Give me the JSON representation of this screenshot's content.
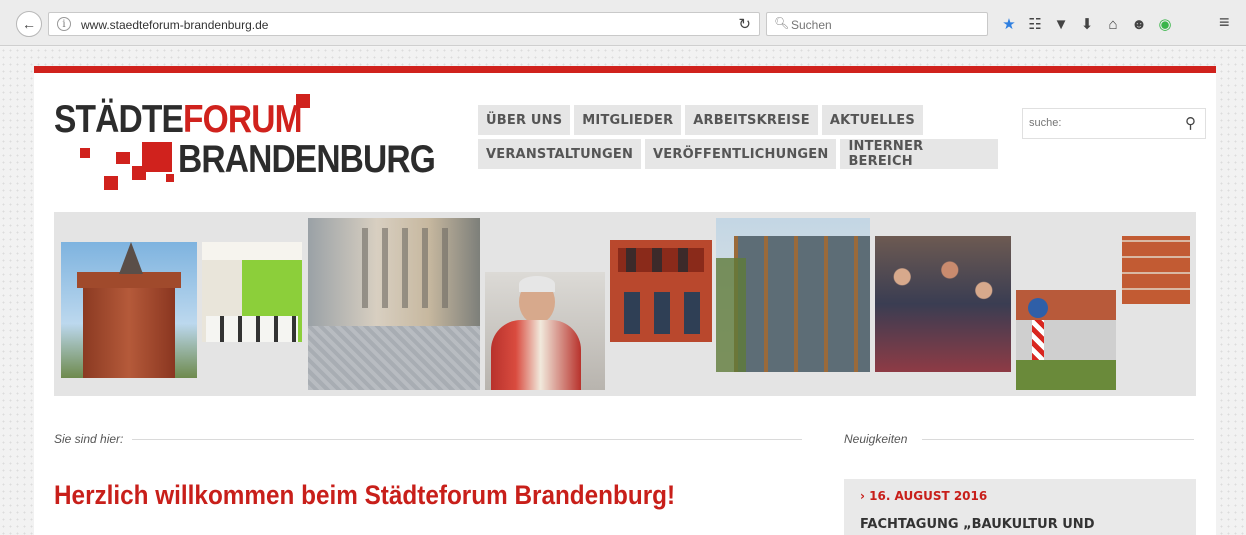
{
  "browser": {
    "url": "www.staedteforum-brandenburg.de",
    "search_placeholder": "Suchen",
    "icons": [
      "back-arrow-icon",
      "info-icon",
      "reload-icon",
      "search-icon",
      "bookmark-star-icon",
      "reading-list-icon",
      "pocket-icon",
      "download-icon",
      "home-icon",
      "chat-icon",
      "extension-icon",
      "hamburger-menu-icon"
    ]
  },
  "logo": {
    "word1": "STÄDTE",
    "word2": "FORUM",
    "word3": "BRANDENBURG",
    "color_dark": "#2c2c2c",
    "color_red": "#d0221d"
  },
  "nav": {
    "row1": [
      "ÜBER UNS",
      "MITGLIEDER",
      "ARBEITSKREISE",
      "AKTUELLES"
    ],
    "row2": [
      "VERANSTALTUNGEN",
      "VERÖFFENTLICHUNGEN",
      "INTERNER BEREICH"
    ]
  },
  "site_search": {
    "placeholder": "suche:"
  },
  "banner_photos": [
    "brick-tower-photo",
    "room-interior-photo",
    "street-cyclist-photo",
    "man-portrait-photo",
    "brick-gothic-facade-photo",
    "glass-building-photo",
    "crowd-photo",
    "traffic-sign-photo",
    "brick-wall-photo"
  ],
  "breadcrumb": {
    "label": "Sie sind hier:"
  },
  "main": {
    "heading": "Herzlich willkommen beim Städteforum Brandenburg!"
  },
  "news": {
    "label": "Neuigkeiten",
    "items": [
      {
        "date": "› 16. AUGUST 2016",
        "title": "FACHTAGUNG „BAUKULTUR UND"
      }
    ]
  },
  "colors": {
    "accent": "#d0221d",
    "nav_bg": "#e6e6e6"
  }
}
